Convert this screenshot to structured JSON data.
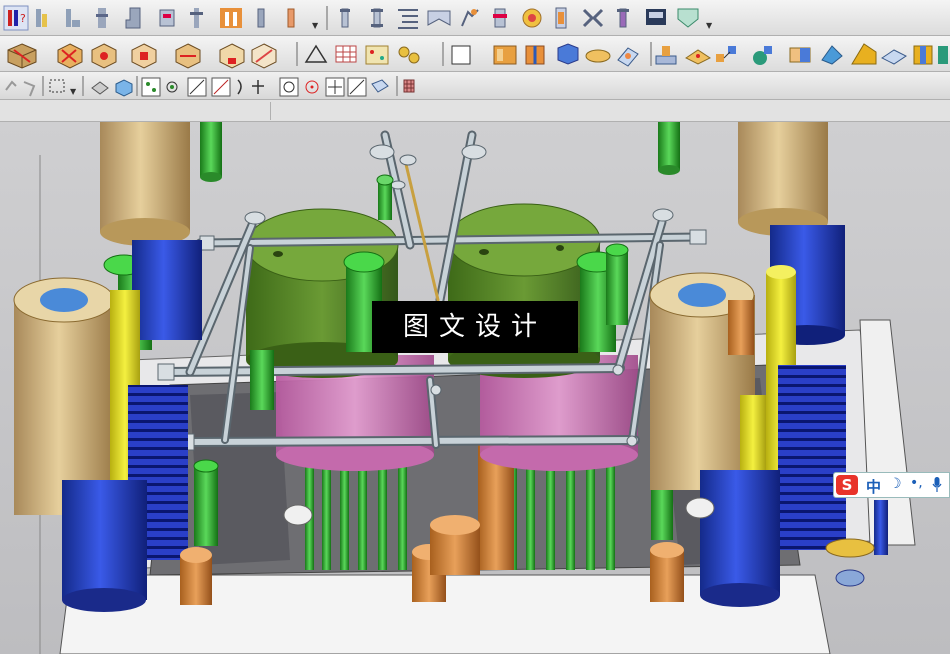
{
  "watermark": {
    "text": "图文设计"
  },
  "ime": {
    "logo": "S",
    "lang": "中",
    "moon": "☽",
    "punct": "•,"
  },
  "toolbars": {
    "row1": [
      "icon-1",
      "icon-2",
      "icon-3",
      "icon-4",
      "icon-5",
      "icon-6",
      "icon-7",
      "icon-8",
      "icon-9",
      "icon-10",
      "icon-11",
      "icon-12",
      "icon-13",
      "icon-14",
      "icon-15",
      "icon-16",
      "icon-17",
      "icon-18",
      "icon-19",
      "icon-20",
      "icon-21",
      "icon-22",
      "icon-23"
    ],
    "row2": [
      "icon-1",
      "icon-2",
      "icon-3",
      "icon-4",
      "icon-5",
      "icon-6",
      "icon-7",
      "icon-8",
      "icon-9",
      "icon-10",
      "icon-11",
      "icon-12",
      "icon-13",
      "icon-14",
      "icon-15",
      "icon-16",
      "icon-17",
      "icon-18",
      "icon-19",
      "icon-20",
      "icon-21",
      "icon-22",
      "icon-23",
      "icon-24",
      "icon-25",
      "icon-26",
      "icon-27"
    ],
    "row3": [
      "icon-1",
      "icon-2",
      "icon-3",
      "icon-4",
      "icon-5",
      "icon-6",
      "icon-7",
      "icon-8",
      "icon-9",
      "icon-10",
      "icon-11",
      "icon-12",
      "icon-13",
      "icon-14",
      "icon-15",
      "icon-16",
      "icon-17"
    ]
  },
  "colors": {
    "mold_plate": "#dcdcdc",
    "cylinder_head": "#5a8a2a",
    "pink_housing": "#d77ab8",
    "blue_spring": "#2a3fc8",
    "tan_pillar": "#d9c08a",
    "yellow_pin": "#e6e21a",
    "orange_pin": "#d8883a",
    "green_pin": "#3bb43b",
    "gray_pipe": "#a8b4bc"
  }
}
